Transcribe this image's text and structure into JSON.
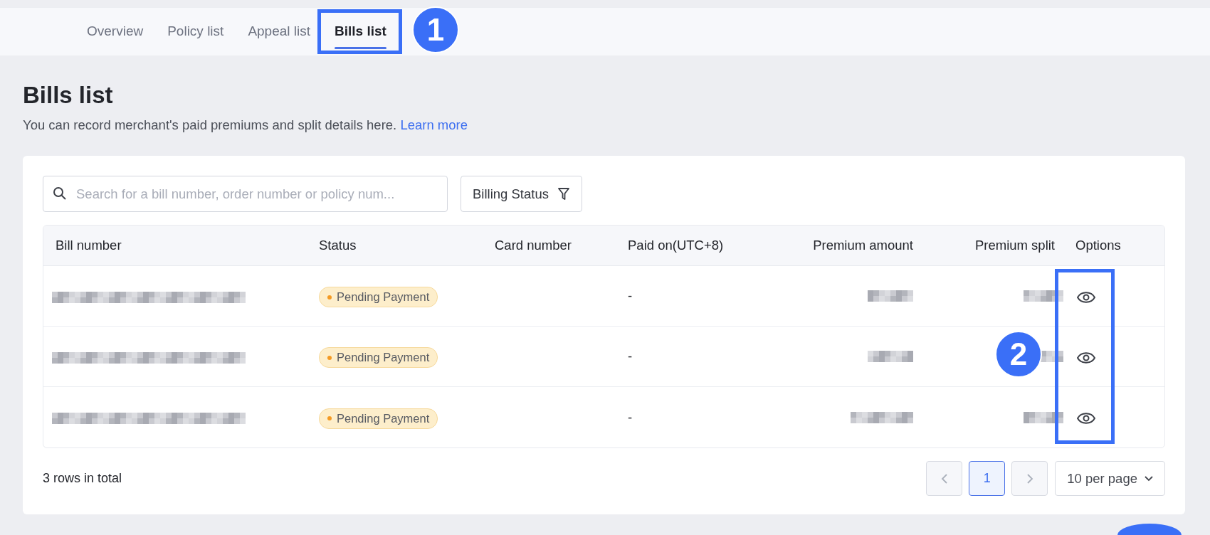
{
  "tabs": [
    {
      "label": "Overview",
      "selected": false
    },
    {
      "label": "Policy list",
      "selected": false
    },
    {
      "label": "Appeal list",
      "selected": false
    },
    {
      "label": "Bills list",
      "selected": true
    }
  ],
  "page": {
    "title": "Bills list",
    "description": "You can record merchant's paid premiums and split details here.",
    "link": "Learn more"
  },
  "search": {
    "placeholder": "Search for a bill number, order number or policy num..."
  },
  "filter": {
    "label": "Billing Status"
  },
  "table": {
    "columns": [
      "Bill number",
      "Status",
      "Card number",
      "Paid on(UTC+8)",
      "Premium amount",
      "Premium split",
      "Options"
    ],
    "rows": [
      {
        "bill_number_redacted": true,
        "status": "Pending Payment",
        "paid_on": "-",
        "premium_amount_redacted": true,
        "premium_split_redacted": true
      },
      {
        "bill_number_redacted": true,
        "status": "Pending Payment",
        "paid_on": "-",
        "premium_amount_redacted": true,
        "premium_split_redacted": true
      },
      {
        "bill_number_redacted": true,
        "status": "Pending Payment",
        "paid_on": "-",
        "premium_amount_redacted": true,
        "premium_split_redacted": true
      }
    ]
  },
  "footer": {
    "total": "3 rows in total",
    "pages": [
      {
        "label": "1",
        "selected": true
      }
    ],
    "per_page": "10 per page"
  },
  "annotations": [
    {
      "kind": "tab",
      "label": "1"
    },
    {
      "kind": "options",
      "label": "2"
    }
  ]
}
